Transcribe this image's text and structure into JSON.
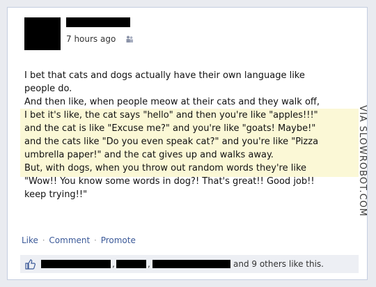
{
  "post": {
    "timestamp": "7 hours ago",
    "audience_icon": "friends-icon",
    "lines": [
      "I bet that cats and dogs actually have their own language like",
      "people do.",
      "And then like, when people meow at their cats and they walk off,",
      "I bet it's like, the cat says \"hello\" and then you're like \"apples!!!\"",
      "and the cat is like \"Excuse me?\" and you're like \"goats! Maybe!\"",
      "and the cats like \"Do you even speak cat?\" and you're like \"Pizza",
      "umbrella paper!\" and the cat gives up and walks away.",
      "But, with dogs, when you throw out random words they're like",
      "\"Wow!! You know some words in dog?! That's great!! Good job!!",
      "keep trying!!\""
    ]
  },
  "actions": {
    "like": "Like",
    "comment": "Comment",
    "promote": "Promote",
    "separator": "·"
  },
  "likes": {
    "comma": ",",
    "others": "and 9 others like this."
  },
  "watermark": "VIA SLOWROBOT.COM",
  "colors": {
    "link": "#3b5998",
    "highlight": "#fbf8d6",
    "likes_bg": "#edeff4"
  }
}
